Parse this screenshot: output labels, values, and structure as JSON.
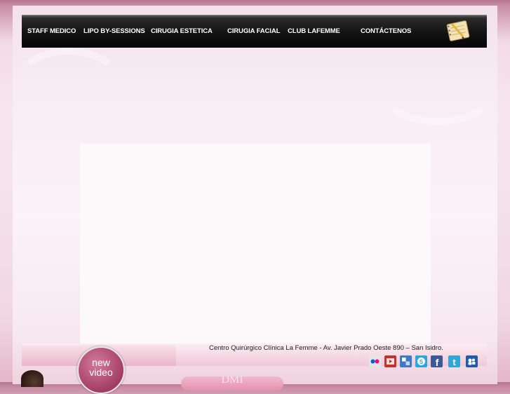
{
  "nav": {
    "items": [
      {
        "label": "STAFF MEDICO"
      },
      {
        "label": "LIPO BY-SESSIONS"
      },
      {
        "label": "CIRUGIA ESTETICA"
      },
      {
        "label": "CIRUGIA FACIAL"
      },
      {
        "label": "CLUB LAFEMME"
      },
      {
        "label": "CONTÁCTENOS"
      }
    ],
    "icon": "notebook-pencil-icon"
  },
  "footer": {
    "address": "Centro Quirúrgico Clínica La Femme - Av. Javier Prado Oeste 890 – San Isidro.",
    "social_icons": [
      {
        "name": "flickr-icon",
        "color": "#e5e5e5"
      },
      {
        "name": "youtube-icon",
        "color": "#c4302b"
      },
      {
        "name": "delicious-icon",
        "color": "#3d79c8"
      },
      {
        "name": "skype-icon",
        "color": "#2aa6e0"
      },
      {
        "name": "facebook-icon",
        "color": "#3b5998"
      },
      {
        "name": "twitter-icon",
        "color": "#33a6d8"
      },
      {
        "name": "myspace-icon",
        "color": "#1e5ca8"
      }
    ]
  },
  "promo": {
    "new_video_line1": "new",
    "new_video_line2": "video",
    "bottom_button_label": "DMI"
  },
  "colors": {
    "navbar": "#111111",
    "accent_pink": "#a23d63"
  }
}
